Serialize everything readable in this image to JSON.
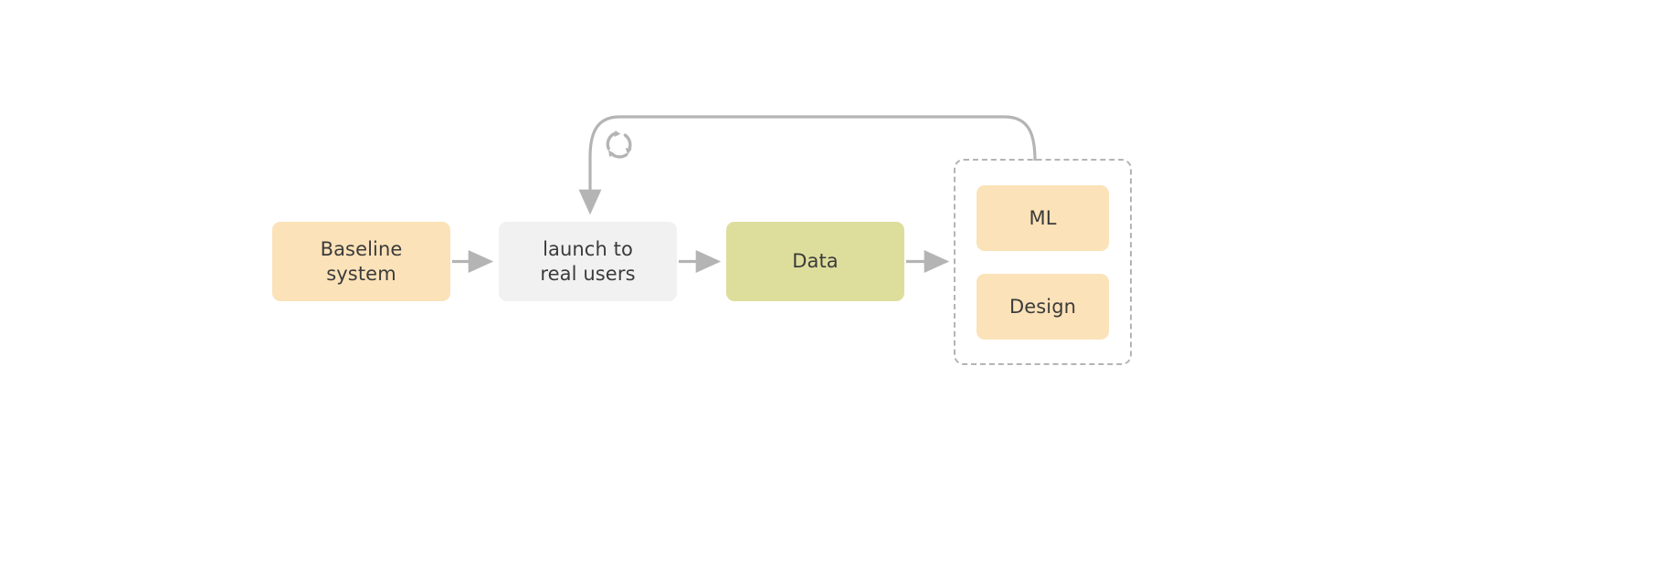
{
  "diagram": {
    "type": "flowchart",
    "title": "",
    "background_color": "#ffffff",
    "colors": {
      "peach": "#FBE2B8",
      "gray_box": "#F1F1F1",
      "green": "#DDDE9C",
      "edge": "#b4b4b4",
      "dashed_border": "#b4b4b4",
      "text": "#3b3b3b"
    },
    "nodes": [
      {
        "id": "baseline",
        "label": "Baseline\nsystem",
        "fill": "#FBE2B8"
      },
      {
        "id": "launch",
        "label": "launch to\nreal users",
        "fill": "#F1F1F1"
      },
      {
        "id": "data",
        "label": "Data",
        "fill": "#DDDE9C"
      },
      {
        "id": "ml",
        "label": "ML",
        "fill": "#FBE2B8"
      },
      {
        "id": "design",
        "label": "Design",
        "fill": "#FBE2B8"
      }
    ],
    "group": {
      "id": "iterate-group",
      "label": "",
      "style": "dashed",
      "members": [
        "ml",
        "design"
      ]
    },
    "edges": [
      {
        "from": "baseline",
        "to": "launch",
        "style": "solid-arrow"
      },
      {
        "from": "launch",
        "to": "data",
        "style": "solid-arrow"
      },
      {
        "from": "data",
        "to": "iterate-group",
        "style": "solid-arrow"
      },
      {
        "from": "iterate-group",
        "to": "launch",
        "style": "curved-feedback-arrow",
        "icon": "recycle-icon"
      }
    ],
    "icons": [
      {
        "name": "recycle-icon",
        "meaning": "iteration loop"
      }
    ]
  }
}
